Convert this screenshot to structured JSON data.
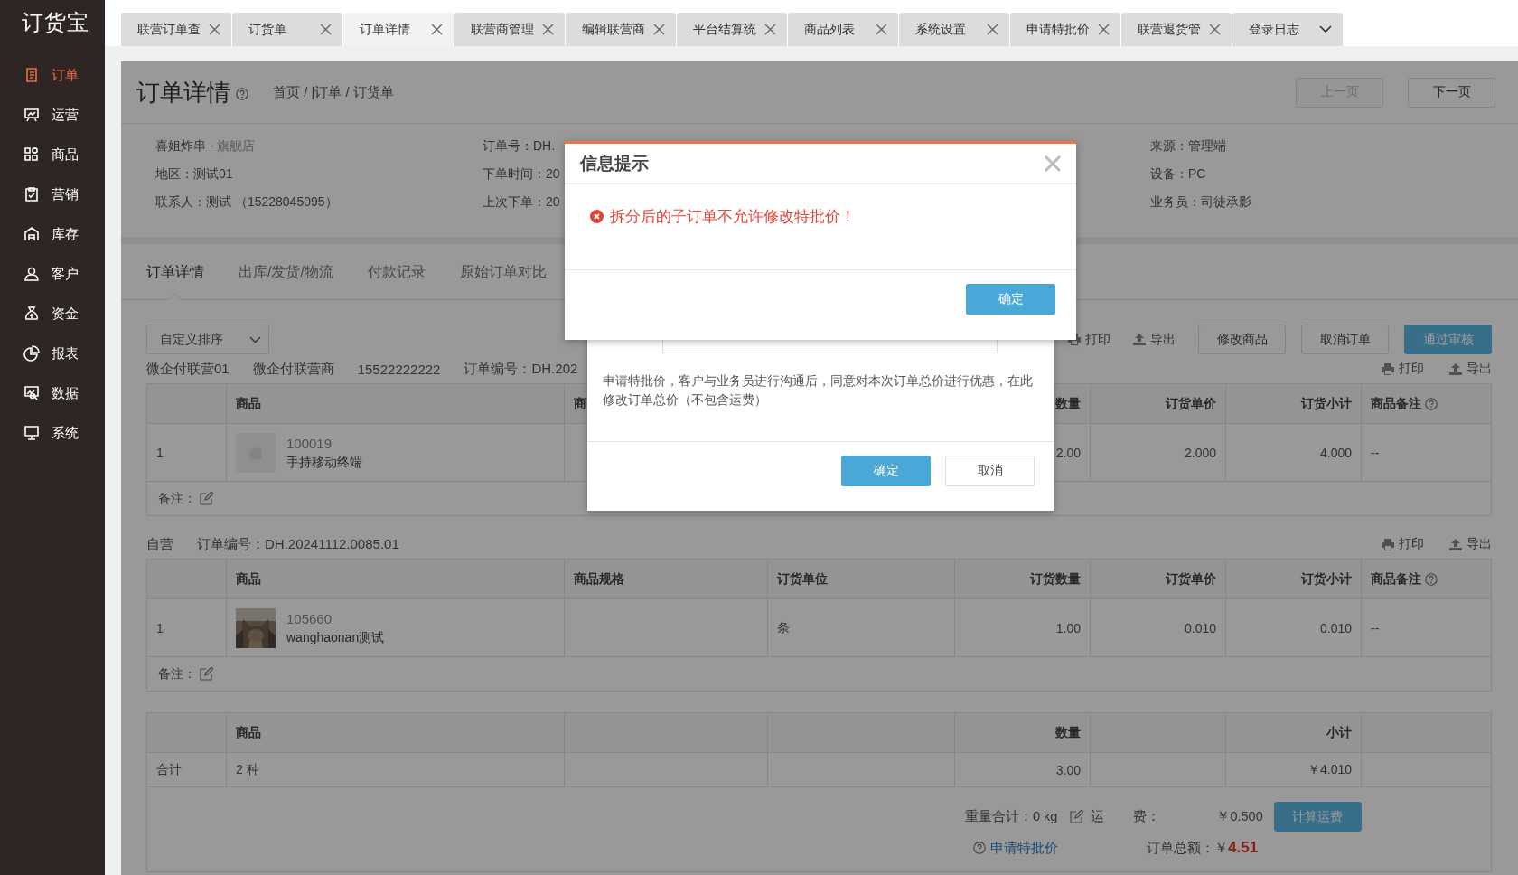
{
  "sidebar": {
    "logo": "订货宝",
    "items": [
      {
        "label": "订单",
        "selected": true
      },
      {
        "label": "运营",
        "selected": false
      },
      {
        "label": "商品",
        "selected": false
      },
      {
        "label": "营销",
        "selected": false
      },
      {
        "label": "库存",
        "selected": false
      },
      {
        "label": "客户",
        "selected": false
      },
      {
        "label": "资金",
        "selected": false
      },
      {
        "label": "报表",
        "selected": false
      },
      {
        "label": "数据",
        "selected": false
      },
      {
        "label": "系统",
        "selected": false
      }
    ]
  },
  "tabs": [
    {
      "label": "联营订单查",
      "selected": false,
      "kind": "close"
    },
    {
      "label": "订货单",
      "selected": false,
      "kind": "close"
    },
    {
      "label": "订单详情",
      "selected": true,
      "kind": "close"
    },
    {
      "label": "联营商管理",
      "selected": false,
      "kind": "close"
    },
    {
      "label": "编辑联营商",
      "selected": false,
      "kind": "close"
    },
    {
      "label": "平台结算统",
      "selected": false,
      "kind": "close"
    },
    {
      "label": "商品列表",
      "selected": false,
      "kind": "close"
    },
    {
      "label": "系统设置",
      "selected": false,
      "kind": "close"
    },
    {
      "label": "申请特批价",
      "selected": false,
      "kind": "close"
    },
    {
      "label": "联营退货管",
      "selected": false,
      "kind": "close"
    },
    {
      "label": "登录日志",
      "selected": false,
      "kind": "menu"
    }
  ],
  "header": {
    "title": "订单详情",
    "breadcrumb": "首页 / |订单 / 订货单",
    "buttons": [
      {
        "label": "上一页",
        "disabled": true
      },
      {
        "label": "下一页",
        "disabled": false
      }
    ]
  },
  "info": {
    "store_name": "喜姐炸串",
    "store_suffix": "- 旗舰店",
    "columns": [
      [
        "地区：测试01",
        "联系人：测试 （15228045095）"
      ],
      [
        "订单号：DH.",
        "下单时间：20",
        "上次下单：20"
      ],
      [
        "来源：管理端",
        "设备：PC",
        "业务员：司徒承影"
      ]
    ]
  },
  "detail_tabs": [
    {
      "label": "订单详情",
      "selected": true
    },
    {
      "label": "出库/发货/物流",
      "selected": false
    },
    {
      "label": "付款记录",
      "selected": false
    },
    {
      "label": "原始订单对比",
      "selected": false
    }
  ],
  "sort_select": {
    "value": "自定义排序"
  },
  "actions": [
    {
      "label": "打印",
      "kind": "print"
    },
    {
      "label": "导出",
      "kind": "export"
    },
    {
      "label": "修改商品",
      "kind": "button"
    },
    {
      "label": "取消订单",
      "kind": "button"
    },
    {
      "label": "通过审核",
      "kind": "primary"
    }
  ],
  "sub_orders": [
    {
      "labels": [
        "微企付联营01",
        "微企付联营商",
        "15522222222",
        "订单编号：DH.202"
      ],
      "tools": [
        {
          "label": "打印",
          "kind": "print"
        },
        {
          "label": "导出",
          "kind": "export"
        }
      ],
      "columns": [
        null,
        {
          "label": "商品"
        },
        {
          "label": "商"
        },
        null,
        {
          "label": "数量"
        },
        {
          "label": "订货单价"
        },
        {
          "label": "订货小计"
        },
        {
          "label": "商品备注",
          "help": true
        }
      ],
      "rows": [
        {
          "cells": [
            "1",
            {
              "kind": "product",
              "code": "100019",
              "name": "手持移动终端"
            },
            null,
            null,
            "2.00",
            "2.000",
            "4.000",
            "--"
          ]
        }
      ],
      "remark_label": "备注："
    },
    {
      "labels": [
        "自营",
        "订单编号：DH.20241112.0085.01"
      ],
      "tools": [
        {
          "label": "打印",
          "kind": "print"
        },
        {
          "label": "导出",
          "kind": "export"
        }
      ],
      "columns": [
        null,
        {
          "label": "商品"
        },
        {
          "label": "商品规格"
        },
        {
          "label": "订货单位"
        },
        {
          "label": "订货数量"
        },
        {
          "label": "订货单价"
        },
        {
          "label": "订货小计"
        },
        {
          "label": "商品备注",
          "help": true
        }
      ],
      "rows": [
        {
          "cells": [
            "1",
            {
              "kind": "product_photo",
              "code": "105660",
              "name": "wanghaonan测试"
            },
            null,
            "条",
            "1.00",
            "0.010",
            "0.010",
            "--"
          ]
        }
      ],
      "remark_label": "备注："
    }
  ],
  "summary": {
    "columns": [
      null,
      {
        "label": "商品"
      },
      null,
      null,
      {
        "label": "数量"
      },
      null,
      {
        "label": "小计"
      },
      null
    ],
    "rows": [
      {
        "cells": [
          "合计",
          "2 种",
          null,
          null,
          "3.00",
          null,
          "￥4.010",
          null
        ]
      }
    ],
    "weight": "重量合计：0 kg",
    "freight_label": "运 费：",
    "freight": "￥0.500",
    "freight_button": "计算运费",
    "special_link": "申请特批价",
    "total_label": "订单总额：￥",
    "total": "4.51"
  },
  "dialogs": [
    {
      "kind": "alert",
      "title": "信息提示",
      "message": "拆分后的子订单不允许修改特批价！",
      "buttons": [
        {
          "label": "确定",
          "kind": "primary"
        }
      ]
    },
    {
      "kind": "form",
      "text": "申请特批价，客户与业务员进行沟通后，同意对本次订单总价进行优惠，在此修改订单总价（不包含运费）",
      "buttons": [
        {
          "label": "确定",
          "kind": "primary"
        },
        {
          "label": "取消",
          "kind": "default"
        }
      ]
    }
  ]
}
